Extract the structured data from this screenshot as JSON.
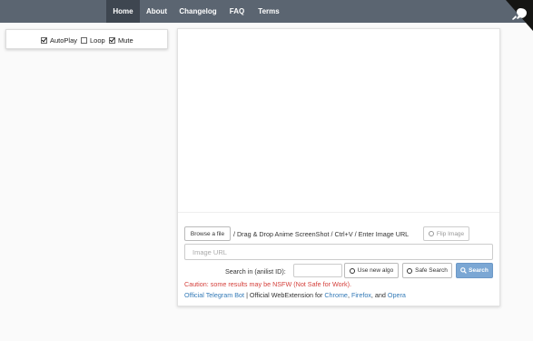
{
  "nav": {
    "items": [
      {
        "label": "Home",
        "active": true
      },
      {
        "label": "About",
        "active": false
      },
      {
        "label": "Changelog",
        "active": false
      },
      {
        "label": "FAQ",
        "active": false
      },
      {
        "label": "Terms",
        "active": false
      }
    ],
    "corner_icon": "github-octocat-icon"
  },
  "options": {
    "autoplay": {
      "label": "AutoPlay",
      "checked": true
    },
    "loop": {
      "label": "Loop",
      "checked": false
    },
    "mute": {
      "label": "Mute",
      "checked": true
    }
  },
  "upload": {
    "browse_label": "Browse a file",
    "instructions": "/ Drag & Drop Anime ScreenShot / Ctrl+V / Enter Image URL",
    "flip_label": "Flip Image",
    "url_placeholder": "Image URL"
  },
  "search": {
    "anilist_label": "Search in (anilist ID):",
    "new_algo_label": "Use new algo",
    "safe_search_label": "Safe Search",
    "search_label": "Search"
  },
  "caution": "Caution: some results may be NSFW (Not Safe for Work).",
  "footer": {
    "telegram": "Official Telegram Bot",
    "separator": "| Official WebExtension for",
    "chrome": "Chrome",
    "comma1": ",",
    "firefox": "Firefox",
    "and": ", and",
    "opera": "Opera"
  },
  "colors": {
    "navbar": "#5b6571",
    "nav_active": "#3e4650",
    "primary_button": "#7ba7d4",
    "warning_text": "#d43f3a",
    "link": "#337ab7"
  }
}
